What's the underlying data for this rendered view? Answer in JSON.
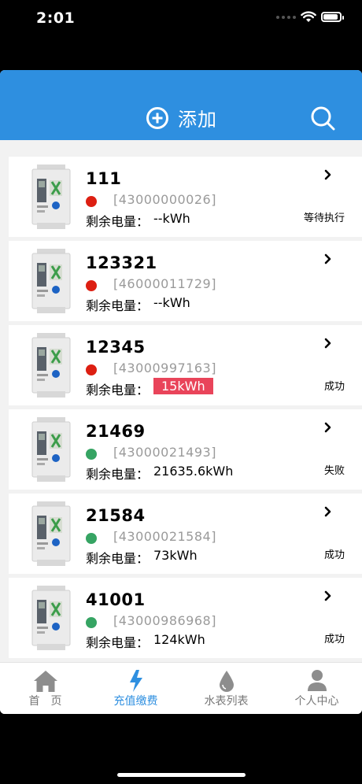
{
  "status_bar": {
    "time": "2:01"
  },
  "header": {
    "add_label": "添加",
    "icons": {
      "add": "plus-circle-icon",
      "search": "search-icon"
    }
  },
  "colors": {
    "header": "#2e8fe0",
    "dot_red": "#dd1f12",
    "dot_green": "#36a463",
    "highlight": "#e9445a"
  },
  "list": {
    "remain_label": "剩余电量：",
    "items": [
      {
        "name": "111",
        "serial": "[43000000026]",
        "dot": "red",
        "remain": "--kWh",
        "status": "等待执行",
        "highlight": false
      },
      {
        "name": "123321",
        "serial": "[46000011729]",
        "dot": "red",
        "remain": "--kWh",
        "status": "",
        "highlight": false
      },
      {
        "name": "12345",
        "serial": "[43000997163]",
        "dot": "red",
        "remain": "15kWh",
        "status": "成功",
        "highlight": true
      },
      {
        "name": "21469",
        "serial": "[43000021493]",
        "dot": "green",
        "remain": "21635.6kWh",
        "status": "失败",
        "highlight": false
      },
      {
        "name": "21584",
        "serial": "[43000021584]",
        "dot": "green",
        "remain": "73kWh",
        "status": "成功",
        "highlight": false
      },
      {
        "name": "41001",
        "serial": "[43000986968]",
        "dot": "green",
        "remain": "124kWh",
        "status": "成功",
        "highlight": false
      }
    ]
  },
  "tabbar": {
    "tabs": [
      {
        "label": "首　页",
        "icon": "home-icon",
        "active": false
      },
      {
        "label": "充值缴费",
        "icon": "lightning-icon",
        "active": true
      },
      {
        "label": "水表列表",
        "icon": "water-drop-icon",
        "active": false
      },
      {
        "label": "个人中心",
        "icon": "person-icon",
        "active": false
      }
    ]
  }
}
